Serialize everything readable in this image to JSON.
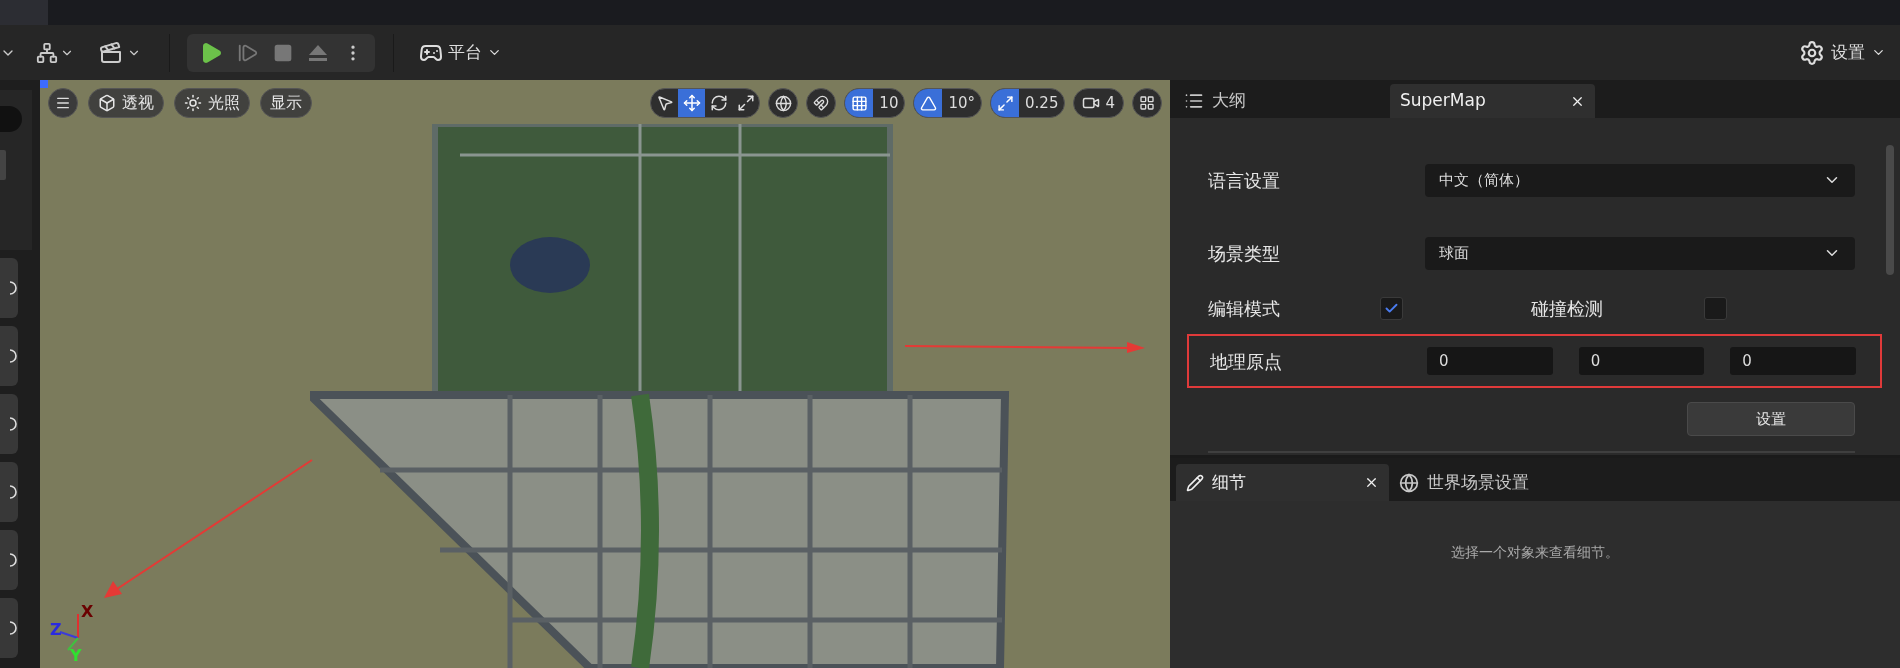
{
  "toolbar": {
    "platform_menu": "平台",
    "settings_menu": "设置"
  },
  "viewport": {
    "toolbar": {
      "view_mode": "透视",
      "lighting": "光照",
      "show": "显示",
      "transform_tools": [
        {
          "kind": "select",
          "selected": false
        },
        {
          "kind": "move",
          "selected": true
        },
        {
          "kind": "rotate",
          "selected": false
        },
        {
          "kind": "scale",
          "selected": false
        }
      ],
      "snaps": [
        {
          "kind": "grid",
          "on": true,
          "value": "10"
        },
        {
          "kind": "angle",
          "on": true,
          "value": "10°"
        },
        {
          "kind": "scale",
          "on": true,
          "value": "0.25"
        }
      ],
      "camera_speed": "4"
    },
    "axis_labels": {
      "x": "X",
      "y": "Y",
      "z": "Z"
    }
  },
  "outliner_panel": {
    "tabs": [
      {
        "label": "大纲",
        "selected": false,
        "closable": false
      },
      {
        "label": "SuperMap",
        "selected": true,
        "closable": true
      }
    ],
    "dropdowns": [
      {
        "label": "语言设置",
        "value": "中文（简体）"
      },
      {
        "label": "场景类型",
        "value": "球面"
      }
    ],
    "toggles": [
      {
        "label": "编辑模式",
        "checked": true
      },
      {
        "label": "碰撞检测",
        "checked": false
      }
    ],
    "origin": {
      "label": "地理原点",
      "values": [
        "0",
        "0",
        "0"
      ],
      "highlighted": true
    },
    "apply_button": "设置"
  },
  "details_panel": {
    "tabs": [
      {
        "label": "细节",
        "selected": true,
        "closable": true
      },
      {
        "label": "世界场景设置",
        "selected": false,
        "closable": false
      }
    ],
    "empty_message": "选择一个对象来查看细节。"
  }
}
